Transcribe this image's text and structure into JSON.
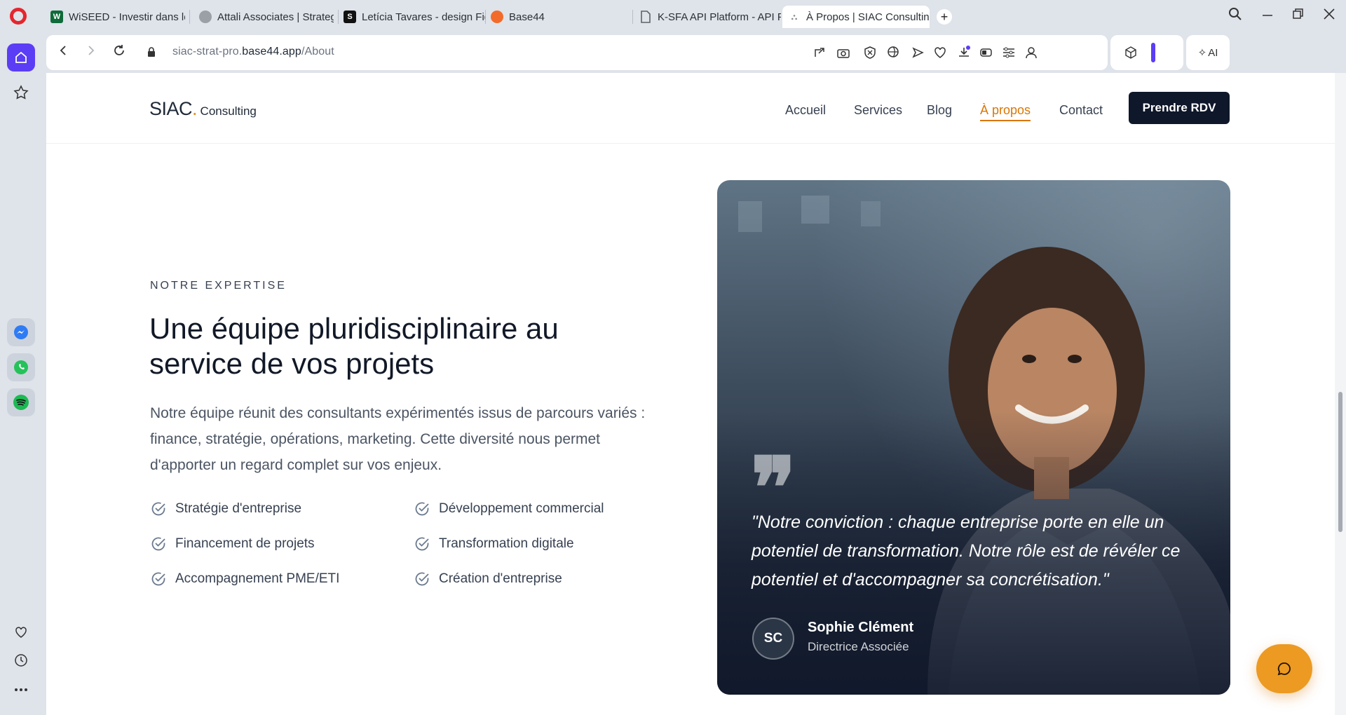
{
  "browser": {
    "tabs": [
      {
        "label": "WiSEED - Investir dans le C",
        "favicon": "W",
        "color": "#0f6b3a"
      },
      {
        "label": "Attali Associates | Strategy",
        "favicon": "",
        "color": "#9aa0a6"
      },
      {
        "label": "Letícia Tavares - design Fig",
        "favicon": "S",
        "color": "#111111"
      },
      {
        "label": "Base44",
        "favicon": "",
        "color": "#f26b2a"
      },
      {
        "label": "K-SFA API Platform - API P",
        "favicon": "",
        "color": "#5f6368"
      },
      {
        "label": "À Propos | SIAC Consulting",
        "favicon": "",
        "color": "#9aa0a6",
        "active": true
      }
    ],
    "new_tab": "+",
    "url": {
      "prefix": "siac-strat-pro.",
      "host": "base44.app",
      "path": "/About"
    },
    "ai_label": "AI"
  },
  "site": {
    "brand": {
      "name": "SIAC",
      "dot": ".",
      "suffix": "Consulting"
    },
    "nav": [
      {
        "label": "Accueil"
      },
      {
        "label": "Services"
      },
      {
        "label": "Blog"
      },
      {
        "label": "À propos",
        "active": true
      },
      {
        "label": "Contact"
      }
    ],
    "cta_label": "Prendre RDV"
  },
  "about": {
    "eyebrow": "NOTRE EXPERTISE",
    "headline": "Une équipe pluridisciplinaire au service de vos projets",
    "lede": "Notre équipe réunit des consultants expérimentés issus de parcours variés : finance, stratégie, opérations, marketing. Cette diversité nous permet d'apporter un regard complet sur vos enjeux.",
    "features": [
      "Stratégie d'entreprise",
      "Développement commercial",
      "Financement de projets",
      "Transformation digitale",
      "Accompagnement PME/ETI",
      "Création d'entreprise"
    ]
  },
  "testimonial": {
    "quote_mark": "❞",
    "quote": "\"Notre conviction : chaque entreprise porte en elle un potentiel de transformation. Notre rôle est de révéler ce potentiel et d'accompagner sa concrétisation.\"",
    "initials": "SC",
    "name": "Sophie Clément",
    "role": "Directrice Associée"
  },
  "colors": {
    "accent": "#d97706",
    "cta_bg": "#0f172a",
    "opera_home": "#5b3df5",
    "chat_fab": "#ec9a22"
  }
}
